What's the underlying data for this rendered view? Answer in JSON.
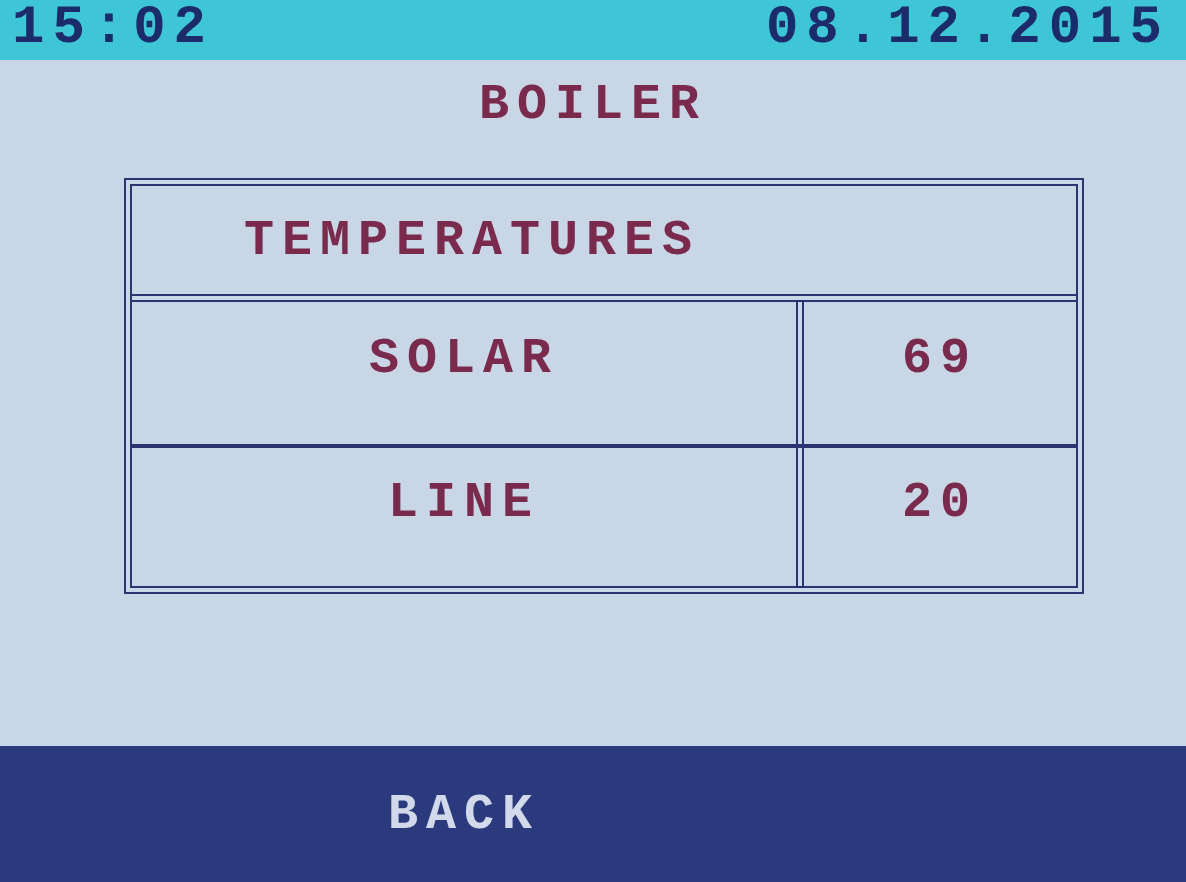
{
  "status_bar": {
    "time": "15:02",
    "date": "08.12.2015"
  },
  "title": "BOILER",
  "table": {
    "title": "TEMPERATURES",
    "rows": [
      {
        "label": "SOLAR",
        "value": "69"
      },
      {
        "label": "LINE",
        "value": "20"
      }
    ]
  },
  "buttons": [
    {
      "label": "BACK"
    }
  ]
}
